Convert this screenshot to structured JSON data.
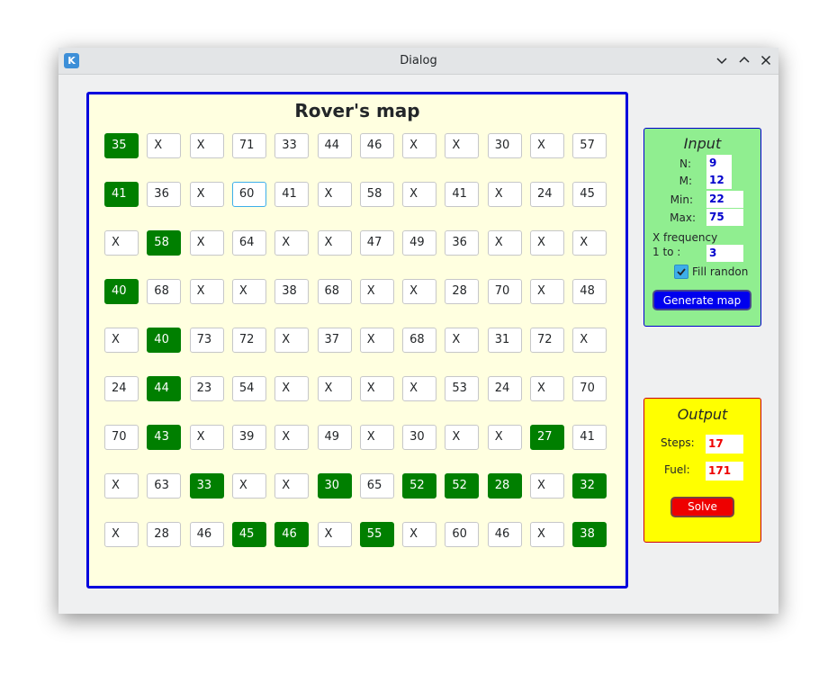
{
  "window": {
    "title": "Dialog",
    "app_icon": "kde-icon"
  },
  "map": {
    "title": "Rover's map",
    "rows": [
      [
        {
          "v": "35",
          "p": true
        },
        {
          "v": "X"
        },
        {
          "v": "X"
        },
        {
          "v": "71"
        },
        {
          "v": "33"
        },
        {
          "v": "44"
        },
        {
          "v": "46"
        },
        {
          "v": "X"
        },
        {
          "v": "X"
        },
        {
          "v": "30"
        },
        {
          "v": "X"
        },
        {
          "v": "57"
        }
      ],
      [
        {
          "v": "41",
          "p": true
        },
        {
          "v": "36"
        },
        {
          "v": "X"
        },
        {
          "v": "60",
          "f": true
        },
        {
          "v": "41"
        },
        {
          "v": "X"
        },
        {
          "v": "58"
        },
        {
          "v": "X"
        },
        {
          "v": "41"
        },
        {
          "v": "X"
        },
        {
          "v": "24"
        },
        {
          "v": "45"
        }
      ],
      [
        {
          "v": "X"
        },
        {
          "v": "58",
          "p": true
        },
        {
          "v": "X"
        },
        {
          "v": "64"
        },
        {
          "v": "X"
        },
        {
          "v": "X"
        },
        {
          "v": "47"
        },
        {
          "v": "49"
        },
        {
          "v": "36"
        },
        {
          "v": "X"
        },
        {
          "v": "X"
        },
        {
          "v": "X"
        }
      ],
      [
        {
          "v": "40",
          "p": true
        },
        {
          "v": "68"
        },
        {
          "v": "X"
        },
        {
          "v": "X"
        },
        {
          "v": "38"
        },
        {
          "v": "68"
        },
        {
          "v": "X"
        },
        {
          "v": "X"
        },
        {
          "v": "28"
        },
        {
          "v": "70"
        },
        {
          "v": "X"
        },
        {
          "v": "48"
        }
      ],
      [
        {
          "v": "X"
        },
        {
          "v": "40",
          "p": true
        },
        {
          "v": "73"
        },
        {
          "v": "72"
        },
        {
          "v": "X"
        },
        {
          "v": "37"
        },
        {
          "v": "X"
        },
        {
          "v": "68"
        },
        {
          "v": "X"
        },
        {
          "v": "31"
        },
        {
          "v": "72"
        },
        {
          "v": "X"
        }
      ],
      [
        {
          "v": "24"
        },
        {
          "v": "44",
          "p": true
        },
        {
          "v": "23"
        },
        {
          "v": "54"
        },
        {
          "v": "X"
        },
        {
          "v": "X"
        },
        {
          "v": "X"
        },
        {
          "v": "X"
        },
        {
          "v": "53"
        },
        {
          "v": "24"
        },
        {
          "v": "X"
        },
        {
          "v": "70"
        }
      ],
      [
        {
          "v": "70"
        },
        {
          "v": "43",
          "p": true
        },
        {
          "v": "X"
        },
        {
          "v": "39"
        },
        {
          "v": "X"
        },
        {
          "v": "49"
        },
        {
          "v": "X"
        },
        {
          "v": "30"
        },
        {
          "v": "X"
        },
        {
          "v": "X"
        },
        {
          "v": "27",
          "p": true
        },
        {
          "v": "41"
        }
      ],
      [
        {
          "v": "X"
        },
        {
          "v": "63"
        },
        {
          "v": "33",
          "p": true
        },
        {
          "v": "X"
        },
        {
          "v": "X"
        },
        {
          "v": "30",
          "p": true
        },
        {
          "v": "65"
        },
        {
          "v": "52",
          "p": true
        },
        {
          "v": "52",
          "p": true
        },
        {
          "v": "28",
          "p": true
        },
        {
          "v": "X"
        },
        {
          "v": "32",
          "p": true
        }
      ],
      [
        {
          "v": "X"
        },
        {
          "v": "28"
        },
        {
          "v": "46"
        },
        {
          "v": "45",
          "p": true
        },
        {
          "v": "46",
          "p": true
        },
        {
          "v": "X"
        },
        {
          "v": "55",
          "p": true
        },
        {
          "v": "X"
        },
        {
          "v": "60"
        },
        {
          "v": "46"
        },
        {
          "v": "X"
        },
        {
          "v": "38",
          "p": true
        }
      ]
    ]
  },
  "input": {
    "title": "Input",
    "n_label": "N:",
    "n_value": "9",
    "m_label": "M:",
    "m_value": "12",
    "min_label": "Min:",
    "min_value": "22",
    "max_label": "Max:",
    "max_value": "75",
    "xfreq_label_1": "X frequency",
    "xfreq_label_2": "1 to :",
    "xfreq_value": "3",
    "fill_label": "Fill randon",
    "fill_checked": true,
    "generate_label": "Generate map"
  },
  "output": {
    "title": "Output",
    "steps_label": "Steps:",
    "steps_value": "17",
    "fuel_label": "Fuel:",
    "fuel_value": "171",
    "solve_label": "Solve"
  },
  "colors": {
    "map_bg": "#ffffe0",
    "map_border": "#0000dd",
    "path_cell": "#007f00",
    "input_bg": "#90ee90",
    "output_bg": "#ffff00",
    "generate_btn": "#0000ee",
    "solve_btn": "#ee0000"
  }
}
